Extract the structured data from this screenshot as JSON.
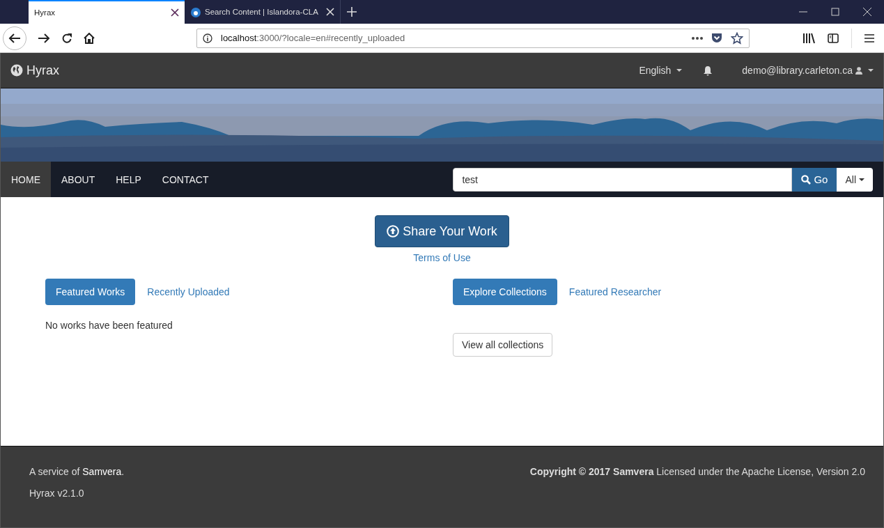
{
  "browser": {
    "tabs": [
      {
        "title": "Hyrax",
        "selected": true,
        "favicon": false
      },
      {
        "title": "Search Content | Islandora-CLA",
        "selected": false,
        "favicon": true
      }
    ],
    "address": {
      "host": "localhost",
      "rest": ":3000/?locale=en#recently_uploaded"
    }
  },
  "site": {
    "brand": "Hyrax",
    "language": "English",
    "user": "demo@library.carleton.ca"
  },
  "nav": {
    "items": [
      {
        "label": "HOME",
        "selected": true
      },
      {
        "label": "ABOUT",
        "selected": false
      },
      {
        "label": "HELP",
        "selected": false
      },
      {
        "label": "CONTACT",
        "selected": false
      }
    ],
    "search": {
      "value": "test",
      "button": "Go",
      "scope": "All"
    }
  },
  "share": {
    "button": "Share Your Work",
    "terms": "Terms of Use"
  },
  "left": {
    "tabs": [
      {
        "label": "Featured Works",
        "selected": true
      },
      {
        "label": "Recently Uploaded",
        "selected": false
      }
    ],
    "message": "No works have been featured"
  },
  "right": {
    "tabs": [
      {
        "label": "Explore Collections",
        "selected": true
      },
      {
        "label": "Featured Researcher",
        "selected": false
      }
    ],
    "button": "View all collections"
  },
  "footer": {
    "service_before": "A service of ",
    "service_link": "Samvera",
    "service_after": ".",
    "version": "Hyrax v2.1.0",
    "copyright": "**Copyright © 2017 Samvera** Licensed under the Apache License, Version 2.0"
  }
}
